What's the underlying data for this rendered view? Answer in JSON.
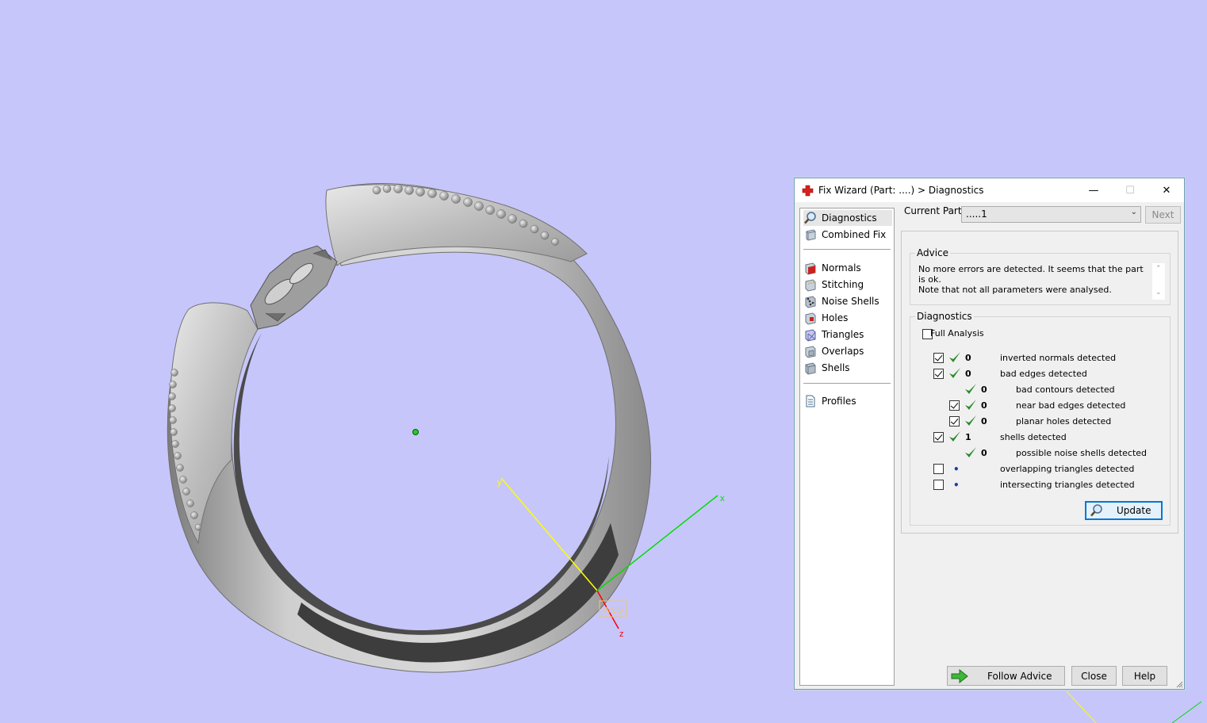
{
  "viewport": {
    "background": "#c6c6fb",
    "axes": {
      "x_label": "x",
      "y_label": "y",
      "z_label": "z",
      "wcs_label": "WCS"
    }
  },
  "dialog": {
    "title": "Fix Wizard (Part: ....) > Diagnostics",
    "title_buttons": {
      "minimize": "—",
      "maximize": "☐",
      "close": "✕"
    },
    "nav": {
      "items_top": [
        {
          "label": "Diagnostics",
          "icon": "magnifier-icon",
          "selected": true
        },
        {
          "label": "Combined Fix",
          "icon": "combined-fix-icon",
          "selected": false
        }
      ],
      "items_mid": [
        {
          "label": "Normals",
          "icon": "normals-icon"
        },
        {
          "label": "Stitching",
          "icon": "stitching-icon"
        },
        {
          "label": "Noise Shells",
          "icon": "noise-shells-icon"
        },
        {
          "label": "Holes",
          "icon": "holes-icon"
        },
        {
          "label": "Triangles",
          "icon": "triangles-icon"
        },
        {
          "label": "Overlaps",
          "icon": "overlaps-icon"
        },
        {
          "label": "Shells",
          "icon": "shells-icon"
        }
      ],
      "items_bottom": [
        {
          "label": "Profiles",
          "icon": "profiles-icon"
        }
      ]
    },
    "current_part": {
      "label": "Current Part:",
      "value": ".....1",
      "next": "Next"
    },
    "advice": {
      "title": "Advice",
      "text": "No more errors are detected. It seems that the part is ok.\nNote that not all parameters were analysed."
    },
    "diagnostics": {
      "title": "Diagnostics",
      "full_analysis": {
        "label": "Full Analysis",
        "checked": false
      },
      "rows": [
        {
          "checkbox": true,
          "checked": true,
          "status": "ok",
          "count": "0",
          "label": "inverted normals detected",
          "indent": 0
        },
        {
          "checkbox": true,
          "checked": true,
          "status": "ok",
          "count": "0",
          "label": "bad edges detected",
          "indent": 0
        },
        {
          "checkbox": false,
          "checked": false,
          "status": "ok",
          "count": "0",
          "label": "bad contours detected",
          "indent": 1
        },
        {
          "checkbox": true,
          "checked": true,
          "status": "ok",
          "count": "0",
          "label": "near bad edges detected",
          "indent": 1
        },
        {
          "checkbox": true,
          "checked": true,
          "status": "ok",
          "count": "0",
          "label": "planar holes detected",
          "indent": 1
        },
        {
          "checkbox": true,
          "checked": true,
          "status": "ok",
          "count": "1",
          "label": "shells detected",
          "indent": 0
        },
        {
          "checkbox": false,
          "checked": false,
          "status": "ok",
          "count": "0",
          "label": "possible noise shells detected",
          "indent": 1
        },
        {
          "checkbox": true,
          "checked": false,
          "status": "none",
          "count": "",
          "label": "overlapping triangles detected",
          "indent": 0
        },
        {
          "checkbox": true,
          "checked": false,
          "status": "none",
          "count": "",
          "label": "intersecting triangles detected",
          "indent": 0
        }
      ],
      "update_label": "Update"
    },
    "buttons": {
      "follow_advice": "Follow Advice",
      "close": "Close",
      "help": "Help"
    },
    "colors": {
      "check_green": "#2a8a2a",
      "accent": "#0078d7"
    }
  }
}
